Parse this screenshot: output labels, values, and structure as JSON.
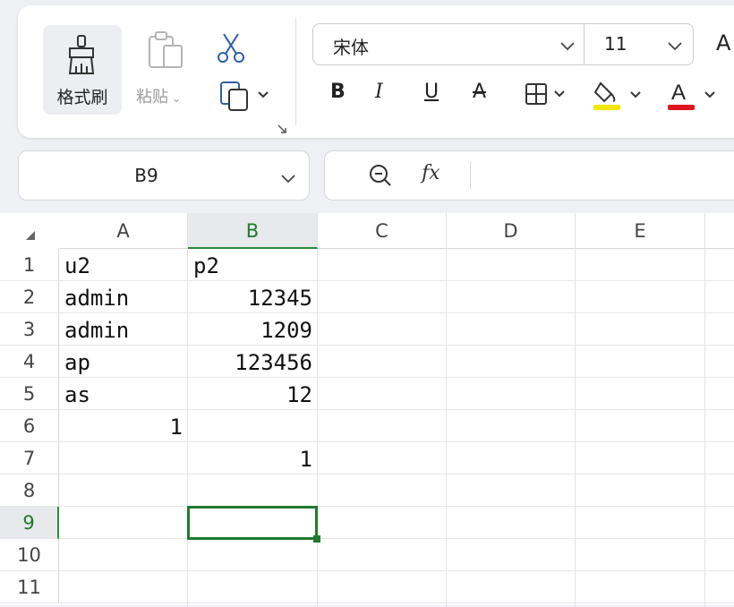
{
  "ribbon": {
    "format_painter_label": "格式刷",
    "paste_label": "粘贴",
    "font_name": "宋体",
    "font_size": "11",
    "grow_font_label": "A",
    "bold_label": "B",
    "italic_label": "I",
    "underline_label": "U",
    "strike_label": "A",
    "fill_color": "#f2e600",
    "font_color": "#e0141e",
    "font_color_label": "A",
    "icons": [
      "format-painter-icon",
      "paste-icon",
      "cut-icon",
      "copy-icon",
      "border-icon",
      "fill-color-icon",
      "font-color-icon"
    ]
  },
  "formula_bar": {
    "name_box": "B9",
    "fx_label": "fx",
    "content": ""
  },
  "sheet": {
    "columns": [
      "A",
      "B",
      "C",
      "D",
      "E"
    ],
    "rows": [
      "1",
      "2",
      "3",
      "4",
      "5",
      "6",
      "7",
      "8",
      "9",
      "10",
      "11"
    ],
    "active_column": "B",
    "active_row": "9",
    "accent_color": "#217a2d",
    "cells": {
      "A1": "u2",
      "B1": "p2",
      "A2": "admin",
      "B2": "12345",
      "A3": "admin",
      "B3": "1209",
      "A4": "ap",
      "B4": "123456",
      "A5": "as",
      "B5": "12",
      "A6": "1",
      "B7": "1"
    }
  }
}
